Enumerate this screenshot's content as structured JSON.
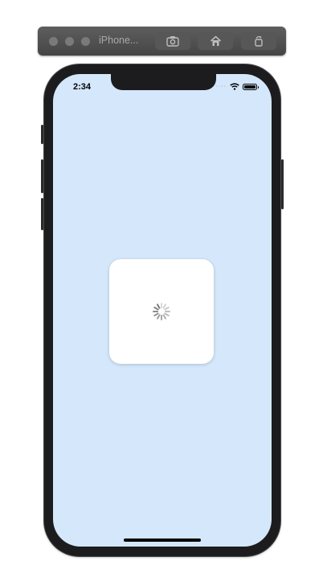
{
  "simulator": {
    "title": "iPhone...",
    "icons": [
      "screenshot-icon",
      "home-icon",
      "rotate-icon"
    ]
  },
  "status_bar": {
    "time": "2:34",
    "icons": [
      "signal-dots-icon",
      "wifi-icon",
      "battery-icon"
    ]
  },
  "loading": {
    "indicator": "activity-spinner-icon"
  },
  "colors": {
    "screen_background": "#d4e7fb",
    "card_background": "#ffffff",
    "device_frame": "#1c1c1e"
  }
}
